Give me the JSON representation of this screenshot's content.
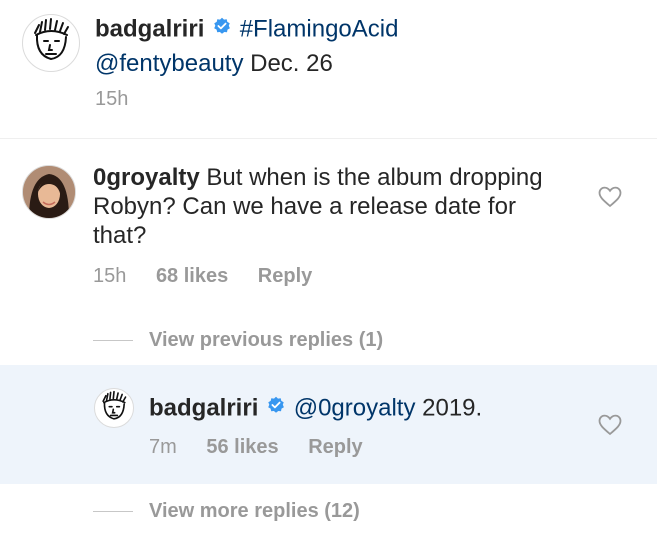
{
  "caption": {
    "username": "badgalriri",
    "hashtag": "#FlamingoAcid",
    "mention": "@fentybeauty",
    "text_rest": " Dec. 26",
    "time": "15h"
  },
  "comment": {
    "username": "0groyalty",
    "text": "But when is the album dropping Robyn? Can we have a release date for that?",
    "time": "15h",
    "likes": "68 likes",
    "reply_label": "Reply"
  },
  "view_previous": {
    "label": "View previous replies (1)"
  },
  "reply": {
    "username": "badgalriri",
    "mention": "@0groyalty",
    "text_rest": " 2019.",
    "time": "7m",
    "likes": "56 likes",
    "reply_label": "Reply",
    "highlight_color": "#eef4fb"
  },
  "view_more": {
    "label": "View more replies (12)"
  },
  "colors": {
    "verified": "#3897f0",
    "link": "#003569",
    "muted": "#999999"
  },
  "icons": [
    "verified-icon",
    "heart-icon",
    "sketch-face-avatar",
    "profile-photo-avatar"
  ]
}
